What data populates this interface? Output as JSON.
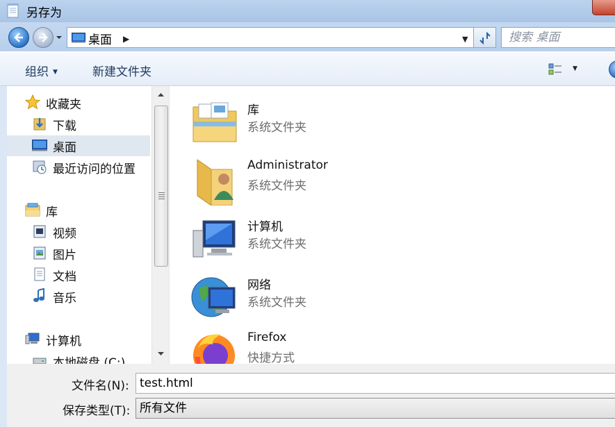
{
  "window": {
    "title": "另存为"
  },
  "address": {
    "location": "桌面",
    "search_placeholder": "搜索 桌面"
  },
  "toolbar": {
    "organize_label": "组织",
    "new_folder_label": "新建文件夹"
  },
  "sidebar": {
    "favorites": {
      "label": "收藏夹",
      "items": [
        {
          "label": "下载",
          "icon": "downloads-icon"
        },
        {
          "label": "桌面",
          "icon": "desktop-icon",
          "selected": true
        },
        {
          "label": "最近访问的位置",
          "icon": "recent-places-icon"
        }
      ]
    },
    "libraries": {
      "label": "库",
      "items": [
        {
          "label": "视频",
          "icon": "videos-icon"
        },
        {
          "label": "图片",
          "icon": "pictures-icon"
        },
        {
          "label": "文档",
          "icon": "documents-icon"
        },
        {
          "label": "音乐",
          "icon": "music-icon"
        }
      ]
    },
    "computer": {
      "label": "计算机",
      "items": [
        {
          "label": "本地磁盘 (C:)",
          "icon": "local-disk-icon"
        }
      ]
    }
  },
  "files": [
    {
      "name": "库",
      "type": "系统文件夹",
      "icon": "libraries-folder-icon"
    },
    {
      "name": "Administrator",
      "type": "系统文件夹",
      "icon": "user-folder-icon"
    },
    {
      "name": "计算机",
      "type": "系统文件夹",
      "icon": "computer-icon"
    },
    {
      "name": "网络",
      "type": "系统文件夹",
      "icon": "network-icon"
    },
    {
      "name": "Firefox",
      "type": "快捷方式",
      "icon": "firefox-icon"
    }
  ],
  "save_form": {
    "filename_label": "文件名(N):",
    "filename_value": "test.html",
    "filetype_label": "保存类型(T):",
    "filetype_value": "所有文件"
  }
}
